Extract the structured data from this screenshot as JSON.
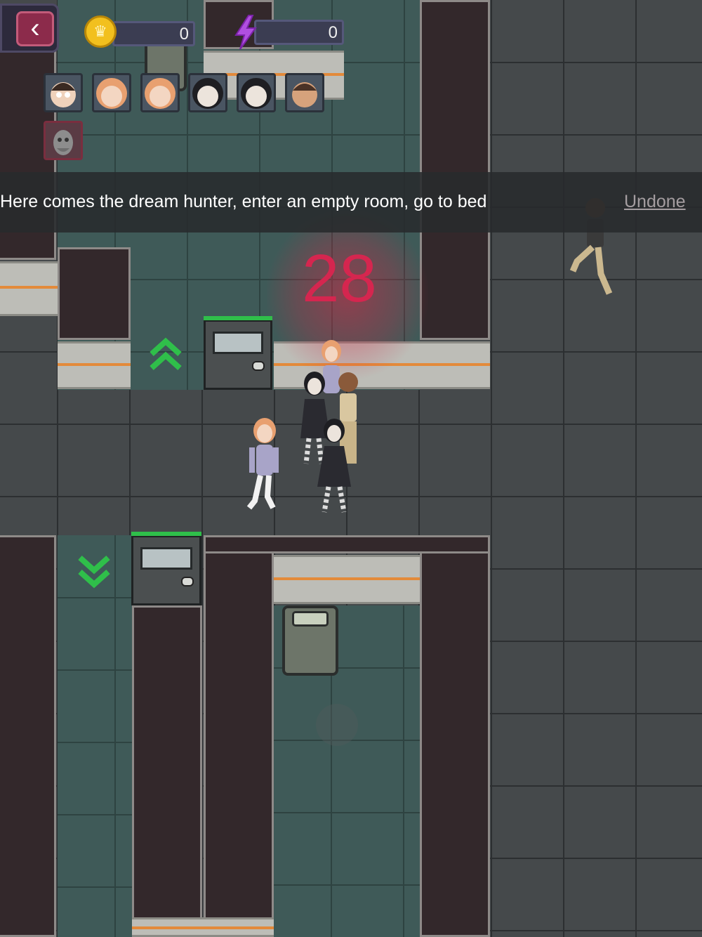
{
  "hud": {
    "back_icon": "chevron-left-icon",
    "coins": "0",
    "energy": "0",
    "coin_icon": "crown-coin-icon",
    "energy_icon": "lightning-bolt-icon"
  },
  "portraits": [
    {
      "name": "boy-dark-hair"
    },
    {
      "name": "girl-orange-hair"
    },
    {
      "name": "girl-orange-hair-2"
    },
    {
      "name": "girl-black-hair"
    },
    {
      "name": "girl-black-hair-2"
    },
    {
      "name": "boy-brown"
    }
  ],
  "hunter_portrait": {
    "name": "dream-hunter"
  },
  "banner": {
    "instruction": "Here comes the dream hunter, enter an empty room, go to bed",
    "undone": "Undone"
  },
  "countdown": "28",
  "colors": {
    "countdown": "#d5264f",
    "arrow_green": "#2fbf4a",
    "room_floor": "#3f5a58",
    "corridor_floor": "#45494b"
  }
}
